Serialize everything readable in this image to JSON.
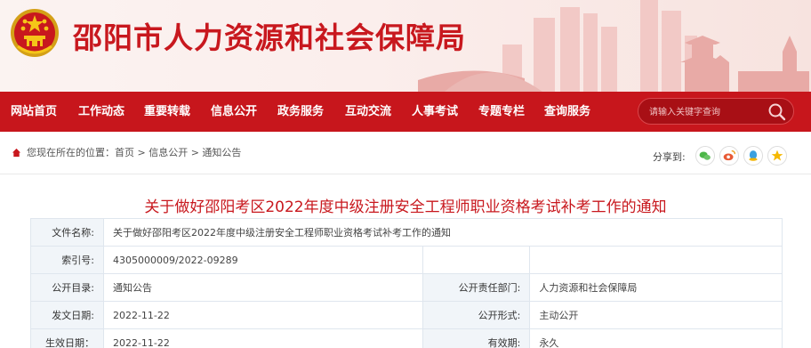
{
  "header": {
    "site_title": "邵阳市人力资源和社会保障局",
    "brand_color": "#c8181e"
  },
  "nav": {
    "items": [
      "网站首页",
      "工作动态",
      "重要转载",
      "信息公开",
      "政务服务",
      "互动交流",
      "人事考试",
      "专题专栏",
      "查询服务"
    ],
    "bg_color": "#c7161c"
  },
  "search": {
    "placeholder": "请输入关键字查询",
    "icon": "search-icon"
  },
  "breadcrumb": {
    "text": "您现在所在的位置：首页 > 信息公开 > 通知公告",
    "icon": "home-icon"
  },
  "share": {
    "label": "分享到:",
    "icons": [
      "wechat-icon",
      "weibo-icon",
      "qq-icon",
      "qzone-icon"
    ]
  },
  "article": {
    "title": "关于做好邵阳考区2022年度中级注册安全工程师职业资格考试补考工作的通知"
  },
  "meta": {
    "file_name_label": "文件名称:",
    "file_name": "关于做好邵阳考区2022年度中级注册安全工程师职业资格考试补考工作的通知",
    "index_label": "索引号:",
    "index": "4305000009/2022-09289",
    "catalog_label": "公开目录:",
    "catalog": "通知公告",
    "dept_label": "公开责任部门:",
    "dept": "人力资源和社会保障局",
    "issue_date_label": "发文日期:",
    "issue_date": "2022-11-22",
    "form_label": "公开形式:",
    "form": "主动公开",
    "effective_label": "生效日期：",
    "effective_date": "2022-11-22",
    "validity_label": "有效期:",
    "validity": "永久"
  }
}
